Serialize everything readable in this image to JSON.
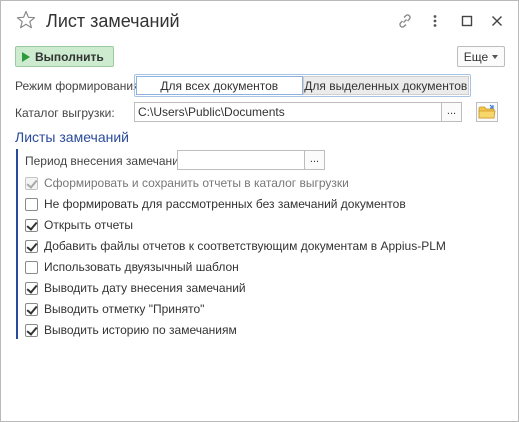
{
  "window": {
    "title": "Лист замечаний"
  },
  "toolbar": {
    "run_label": "Выполнить",
    "more_label": "Еще"
  },
  "mode": {
    "label": "Режим формирования:",
    "options": [
      "Для всех документов",
      "Для выделенных документов"
    ],
    "selected": "Для всех документов"
  },
  "catalog": {
    "label": "Каталог выгрузки:",
    "value": "C:\\Users\\Public\\Documents",
    "choose_label": "..."
  },
  "sheets": {
    "title": "Листы замечаний",
    "period_label": "Период внесения замечаний:",
    "period_value": "",
    "period_choose_label": "...",
    "options": [
      {
        "label": "Сформировать и сохранить отчеты в каталог выгрузки",
        "checked": true,
        "disabled": true
      },
      {
        "label": "Не формировать для рассмотренных без замечаний документов",
        "checked": false,
        "disabled": false
      },
      {
        "label": "Открыть отчеты",
        "checked": true,
        "disabled": false
      },
      {
        "label": "Добавить файлы отчетов к соответствующим документам в Appius-PLM",
        "checked": true,
        "disabled": false
      },
      {
        "label": "Использовать двуязычный шаблон",
        "checked": false,
        "disabled": false
      },
      {
        "label": "Выводить дату внесения замечаний",
        "checked": true,
        "disabled": false
      },
      {
        "label": "Выводить отметку \"Принято\"",
        "checked": true,
        "disabled": false
      },
      {
        "label": "Выводить историю по замечаниям",
        "checked": true,
        "disabled": false
      }
    ]
  },
  "colors": {
    "run_button_bg": "#cdeccf",
    "accent_blue": "#2a4b9b",
    "play_green": "#2e9a3c"
  },
  "icons": {
    "favorite": "star-icon",
    "link": "link-icon",
    "menu": "more-vertical-icon",
    "maximize": "maximize-icon",
    "close": "close-icon",
    "folder": "folder-icon"
  }
}
